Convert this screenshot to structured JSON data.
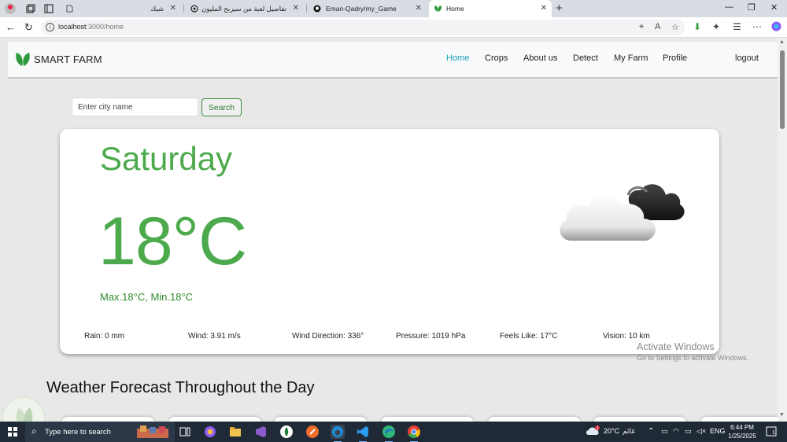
{
  "browser": {
    "tabs": [
      {
        "title": "شبك"
      },
      {
        "title": "تفاصيل لعبة من سيربح المليون"
      },
      {
        "title": "Eman-Qadry/my_Game"
      },
      {
        "title": "Home"
      }
    ],
    "address": {
      "host": "localhost",
      "rest": ":3000/home"
    }
  },
  "app": {
    "brand": "SMART FARM",
    "nav": [
      "Home",
      "Crops",
      "About us",
      "Detect",
      "My Farm",
      "Profile"
    ],
    "logout": "logout",
    "accent": "#4caa4c"
  },
  "search": {
    "placeholder": "Enter city name",
    "button": "Search"
  },
  "weather": {
    "day": "Saturday",
    "temp": "18°C",
    "minmax": "Max.18°C, Min.18°C",
    "condition_icon": "cloud-partly-dark-icon",
    "stats": [
      "Rain: 0 mm",
      "Wind: 3.91 m/s",
      "Wind Direction: 336°",
      "Pressure: 1019 hPa",
      "Feels Like: 17°C",
      "Vision: 10 km"
    ]
  },
  "forecast": {
    "title": "Weather Forecast Throughout the Day"
  },
  "watermark": {
    "line1": "Activate Windows",
    "line2": "Go to Settings to activate Windows."
  },
  "taskbar": {
    "search_placeholder": "Type here to search",
    "weather": "20°C",
    "weather_desc": "غائم",
    "lang": "ENG",
    "time": "6:44 PM",
    "date": "1/25/2025",
    "notifications": "1"
  }
}
